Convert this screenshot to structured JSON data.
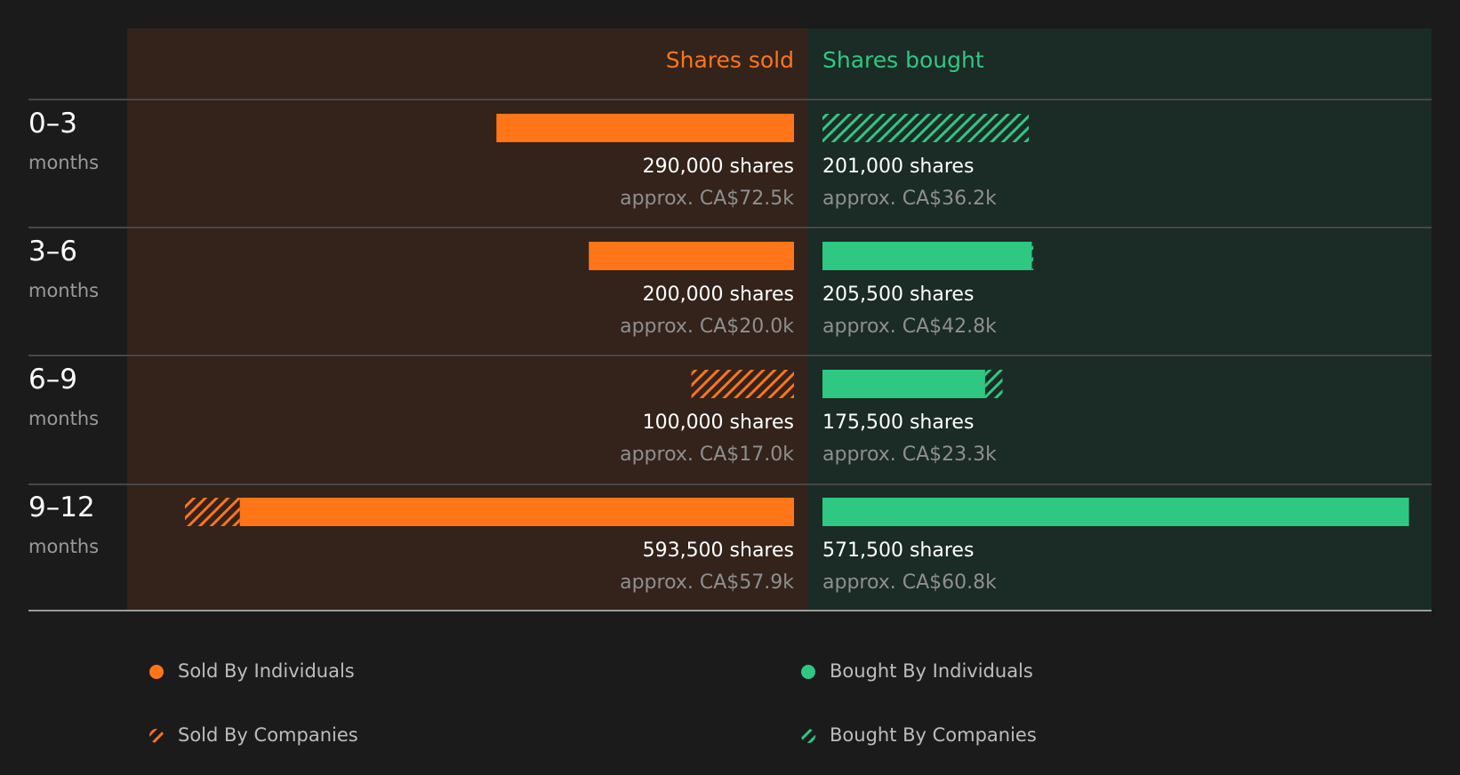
{
  "colors": {
    "background": "#1b1b1b",
    "sold_panel": "#33231b",
    "bought_panel": "#1b2b25",
    "sold": "#ff7518",
    "bought": "#2ec883",
    "divider": "#474747"
  },
  "chart_data": {
    "type": "bar",
    "layout": "diverging-horizontal",
    "headers": {
      "sold": "Shares sold",
      "bought": "Shares bought"
    },
    "max_shares": 593500,
    "rows": [
      {
        "period": "0–3",
        "unit": "months",
        "sold": {
          "individuals": 290000,
          "companies": 0,
          "total_label": "290,000 shares",
          "value_label": "approx. CA$72.5k"
        },
        "bought": {
          "individuals": 0,
          "companies": 201000,
          "total_label": "201,000 shares",
          "value_label": "approx. CA$36.2k"
        }
      },
      {
        "period": "3–6",
        "unit": "months",
        "sold": {
          "individuals": 200000,
          "companies": 0,
          "total_label": "200,000 shares",
          "value_label": "approx. CA$20.0k"
        },
        "bought": {
          "individuals": 204000,
          "companies": 1500,
          "total_label": "205,500 shares",
          "value_label": "approx. CA$42.8k"
        }
      },
      {
        "period": "6–9",
        "unit": "months",
        "sold": {
          "individuals": 0,
          "companies": 100000,
          "total_label": "100,000 shares",
          "value_label": "approx. CA$17.0k"
        },
        "bought": {
          "individuals": 158500,
          "companies": 17000,
          "total_label": "175,500 shares",
          "value_label": "approx. CA$23.3k"
        }
      },
      {
        "period": "9–12",
        "unit": "months",
        "sold": {
          "individuals": 540000,
          "companies": 53500,
          "total_label": "593,500 shares",
          "value_label": "approx. CA$57.9k"
        },
        "bought": {
          "individuals": 571500,
          "companies": 0,
          "total_label": "571,500 shares",
          "value_label": "approx. CA$60.8k"
        }
      }
    ],
    "legend": [
      {
        "label": "Sold By Individuals",
        "side": "sold",
        "pattern": "solid"
      },
      {
        "label": "Bought By Individuals",
        "side": "bought",
        "pattern": "solid"
      },
      {
        "label": "Sold By Companies",
        "side": "sold",
        "pattern": "hatched"
      },
      {
        "label": "Bought By Companies",
        "side": "bought",
        "pattern": "hatched"
      }
    ]
  }
}
